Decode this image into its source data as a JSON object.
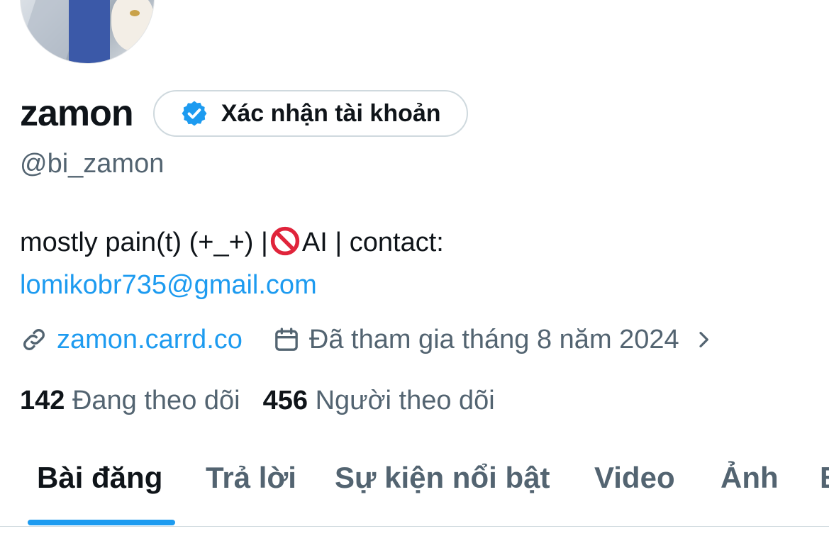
{
  "profile": {
    "display_name": "zamon",
    "verify_button_label": "Xác nhận tài khoản",
    "handle": "@bi_zamon",
    "bio_text": "mostly pain(t) (+_+) |",
    "bio_ai": "AI | contact:",
    "bio_email": "lomikobr735@gmail.com",
    "website": "zamon.carrd.co",
    "joined": "Đã tham gia tháng 8 năm 2024"
  },
  "stats": {
    "following_count": "142",
    "following_label": "Đang theo dõi",
    "followers_count": "456",
    "followers_label": "Người theo dõi"
  },
  "tabs": [
    {
      "label": "Bài đăng",
      "active": true
    },
    {
      "label": "Trả lời",
      "active": false
    },
    {
      "label": "Sự kiện nổi bật",
      "active": false
    },
    {
      "label": "Video",
      "active": false
    },
    {
      "label": "Ảnh",
      "active": false
    },
    {
      "label": "B",
      "active": false
    }
  ],
  "icons": {
    "verified": "verified-badge-icon",
    "link": "link-icon",
    "calendar": "calendar-icon",
    "chevron": "chevron-right-icon",
    "prohibited": "prohibited-icon"
  },
  "colors": {
    "accent": "#1d9bf0",
    "text_primary": "#0f1419",
    "text_secondary": "#536471",
    "border": "#cfd9de",
    "prohibited": "#e0243b"
  }
}
